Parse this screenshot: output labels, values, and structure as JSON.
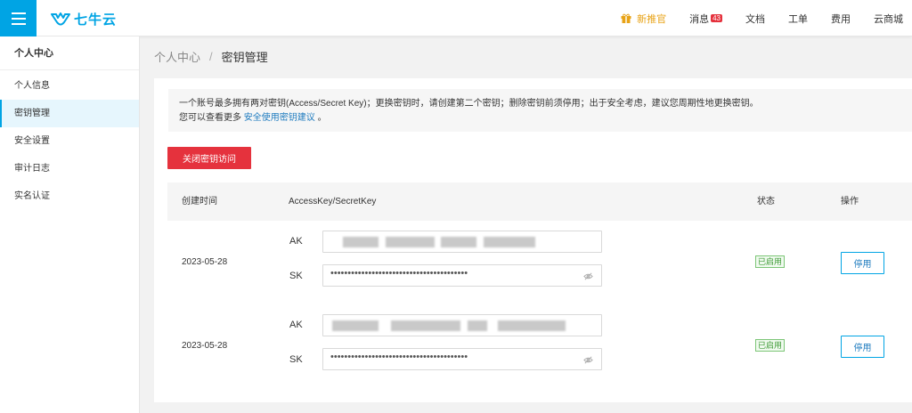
{
  "brand": {
    "name": "七牛云",
    "color": "#00a4e4"
  },
  "topnav": [
    {
      "label": "新推官",
      "icon": "gift-icon",
      "promo": true
    },
    {
      "label": "消息",
      "badge": "43"
    },
    {
      "label": "文档"
    },
    {
      "label": "工单"
    },
    {
      "label": "费用"
    },
    {
      "label": "云商城"
    }
  ],
  "sidebar": {
    "title": "个人中心",
    "items": [
      {
        "label": "个人信息"
      },
      {
        "label": "密钥管理",
        "active": true
      },
      {
        "label": "安全设置"
      },
      {
        "label": "审计日志"
      },
      {
        "label": "实名认证"
      }
    ]
  },
  "breadcrumb": {
    "parent": "个人中心",
    "separator": "/",
    "current": "密钥管理"
  },
  "notice": {
    "line1": "一个账号最多拥有两对密钥(Access/Secret Key)；更换密钥时，请创建第二个密钥；删除密钥前须停用；出于安全考虑，建议您周期性地更换密钥。",
    "line2_prefix": "您可以查看更多",
    "line2_link": "安全使用密钥建议",
    "line2_suffix": "。"
  },
  "close_access_button": "关闭密钥访问",
  "table": {
    "headers": {
      "created": "创建时间",
      "keys": "AccessKey/SecretKey",
      "status": "状态",
      "actions": "操作"
    },
    "rows": [
      {
        "date": "2023-05-28",
        "ak_label": "AK",
        "sk_label": "SK",
        "sk_value": "••••••••••••••••••••••••••••••••••••••••",
        "status": "已启用",
        "action": "停用"
      },
      {
        "date": "2023-05-28",
        "ak_label": "AK",
        "sk_label": "SK",
        "sk_value": "••••••••••••••••••••••••••••••••••••••••",
        "status": "已启用",
        "action": "停用"
      }
    ]
  },
  "colors": {
    "accent": "#00a4e4",
    "danger": "#e5323d",
    "success": "#3e9b36",
    "promo": "#e8a317"
  }
}
